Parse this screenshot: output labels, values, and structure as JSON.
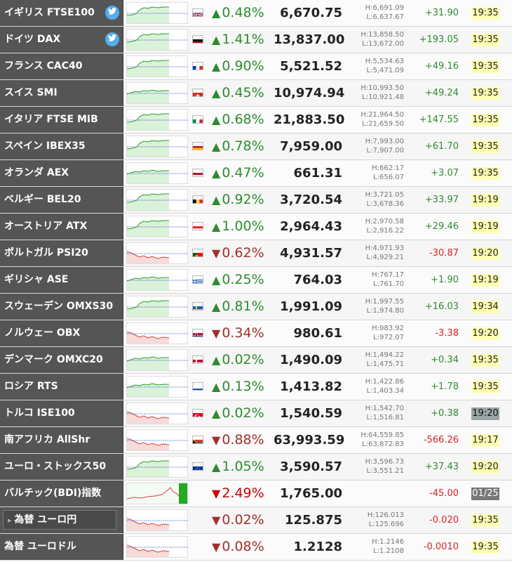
{
  "rows": [
    {
      "name": "イギリス FTSE100",
      "twitter": true,
      "flag": "uk",
      "pct": "0.48%",
      "dir": "up",
      "value": "6,670.75",
      "high": "H:6,691.09",
      "low": "L:6,637.67",
      "change": "+31.90",
      "time": "19:35",
      "time_style": "yellow",
      "spark": "up"
    },
    {
      "name": "ドイツ DAX",
      "twitter": true,
      "flag": "de",
      "pct": "1.41%",
      "dir": "up",
      "value": "13,837.00",
      "high": "H:13,858.50",
      "low": "L:13,672.00",
      "change": "+193.05",
      "time": "19:35",
      "time_style": "yellow",
      "spark": "up"
    },
    {
      "name": "フランス CAC40",
      "twitter": false,
      "flag": "fr",
      "pct": "0.90%",
      "dir": "up",
      "value": "5,521.52",
      "high": "H:5,534.63",
      "low": "L:5,471.09",
      "change": "+49.16",
      "time": "19:35",
      "time_style": "yellow",
      "spark": "up"
    },
    {
      "name": "スイス SMI",
      "twitter": false,
      "flag": "ch",
      "pct": "0.45%",
      "dir": "up",
      "value": "10,974.94",
      "high": "H:10,993.50",
      "low": "L:10,921.48",
      "change": "+49.24",
      "time": "19:35",
      "time_style": "yellow",
      "spark": "flat"
    },
    {
      "name": "イタリア FTSE MIB",
      "twitter": false,
      "flag": "it",
      "pct": "0.68%",
      "dir": "up",
      "value": "21,883.50",
      "high": "H:21,964.50",
      "low": "L:21,659.50",
      "change": "+147.55",
      "time": "19:35",
      "time_style": "yellow",
      "spark": "up"
    },
    {
      "name": "スペイン IBEX35",
      "twitter": false,
      "flag": "es",
      "pct": "0.78%",
      "dir": "up",
      "value": "7,959.00",
      "high": "H:7,993.00",
      "low": "L:7,907.00",
      "change": "+61.70",
      "time": "19:35",
      "time_style": "yellow",
      "spark": "up"
    },
    {
      "name": "オランダ AEX",
      "twitter": false,
      "flag": "nl",
      "pct": "0.47%",
      "dir": "up",
      "value": "661.31",
      "high": "H:662.17",
      "low": "L:656.07",
      "change": "+3.07",
      "time": "19:35",
      "time_style": "yellow",
      "spark": "flat"
    },
    {
      "name": "ベルギー BEL20",
      "twitter": false,
      "flag": "be",
      "pct": "0.92%",
      "dir": "up",
      "value": "3,720.54",
      "high": "H:3,721.05",
      "low": "L:3,678.36",
      "change": "+33.97",
      "time": "19:19",
      "time_style": "yellow",
      "spark": "up"
    },
    {
      "name": "オーストリア ATX",
      "twitter": false,
      "flag": "at",
      "pct": "1.00%",
      "dir": "up",
      "value": "2,964.43",
      "high": "H:2,970.58",
      "low": "L:2,916.22",
      "change": "+29.46",
      "time": "19:19",
      "time_style": "yellow",
      "spark": "up"
    },
    {
      "name": "ポルトガル PSI20",
      "twitter": false,
      "flag": "pt",
      "pct": "0.62%",
      "dir": "down",
      "value": "4,931.57",
      "high": "H:4,971.93",
      "low": "L:4,929.21",
      "change": "-30.87",
      "time": "19:20",
      "time_style": "yellow",
      "spark": "down"
    },
    {
      "name": "ギリシャ ASE",
      "twitter": false,
      "flag": "gr",
      "pct": "0.25%",
      "dir": "up",
      "value": "764.03",
      "high": "H:767.17",
      "low": "L:761.70",
      "change": "+1.90",
      "time": "19:19",
      "time_style": "yellow",
      "spark": "flat"
    },
    {
      "name": "スウェーデン OMXS30",
      "twitter": false,
      "flag": "se",
      "pct": "0.81%",
      "dir": "up",
      "value": "1,991.09",
      "high": "H:1,997.55",
      "low": "L:1,974.80",
      "change": "+16.03",
      "time": "19:34",
      "time_style": "yellow",
      "spark": "up"
    },
    {
      "name": "ノルウェー OBX",
      "twitter": false,
      "flag": "no",
      "pct": "0.34%",
      "dir": "down",
      "value": "980.61",
      "high": "H:983.92",
      "low": "L:972.07",
      "change": "-3.38",
      "time": "19:20",
      "time_style": "yellow",
      "spark": "down"
    },
    {
      "name": "デンマーク OMXC20",
      "twitter": false,
      "flag": "dk",
      "pct": "0.02%",
      "dir": "up",
      "value": "1,490.09",
      "high": "H:1,494.22",
      "low": "L:1,475.71",
      "change": "+0.34",
      "time": "19:35",
      "time_style": "yellow",
      "spark": "flat"
    },
    {
      "name": "ロシア RTS",
      "twitter": false,
      "flag": "ru",
      "pct": "0.13%",
      "dir": "up",
      "value": "1,413.82",
      "high": "H:1,422.86",
      "low": "L:1,403.34",
      "change": "+1.78",
      "time": "19:35",
      "time_style": "yellow",
      "spark": "flat"
    },
    {
      "name": "トルコ ISE100",
      "twitter": false,
      "flag": "tr",
      "pct": "0.02%",
      "dir": "up",
      "value": "1,540.59",
      "high": "H:1,542.70",
      "low": "L:1,516.81",
      "change": "+0.38",
      "time": "19:20",
      "time_style": "gray",
      "spark": "down"
    },
    {
      "name": "南アフリカ AllShr",
      "twitter": false,
      "flag": "za",
      "pct": "0.88%",
      "dir": "down",
      "value": "63,993.59",
      "high": "H:64,559.85",
      "low": "L:63,872.83",
      "change": "-566.26",
      "time": "19:17",
      "time_style": "yellow",
      "spark": "down"
    },
    {
      "name": "ユーロ・ストックス50",
      "twitter": false,
      "flag": "eu",
      "pct": "1.05%",
      "dir": "up",
      "value": "3,590.57",
      "high": "H:3,596.73",
      "low": "L:3,551.21",
      "change": "+37.43",
      "time": "19:20",
      "time_style": "yellow",
      "spark": "up"
    },
    {
      "name": "バルチック(BDI)指数",
      "twitter": false,
      "flag": "",
      "pct": "2.49%",
      "dir": "down2",
      "value": "1,765.00",
      "high": "",
      "low": "",
      "change": "-45.00",
      "time": "01/25",
      "time_style": "dark",
      "spark": "bdi"
    },
    {
      "name": "為替 ユーロ円",
      "twitter": false,
      "flag": "",
      "pct": "0.02%",
      "dir": "down",
      "value": "125.875",
      "high": "H:126.013",
      "low": "L:125.696",
      "change": "-0.020",
      "time": "19:35",
      "time_style": "yellow",
      "spark": "down",
      "inset": true
    },
    {
      "name": "為替 ユーロドル",
      "twitter": false,
      "flag": "",
      "pct": "0.08%",
      "dir": "down",
      "value": "1.2128",
      "high": "H:1.2146",
      "low": "L:1.2108",
      "change": "-0.0010",
      "time": "19:35",
      "time_style": "yellow",
      "spark": "down"
    }
  ],
  "colors": {
    "up": "#2e8b2e",
    "down": "#a0302c",
    "down_red": "#cc0000",
    "time_bg": "#ffffb3",
    "name_bg": "#555555"
  },
  "icons": {
    "twitter": "twitter-bird-icon",
    "up": "triangle-up-icon",
    "down": "triangle-down-icon"
  }
}
